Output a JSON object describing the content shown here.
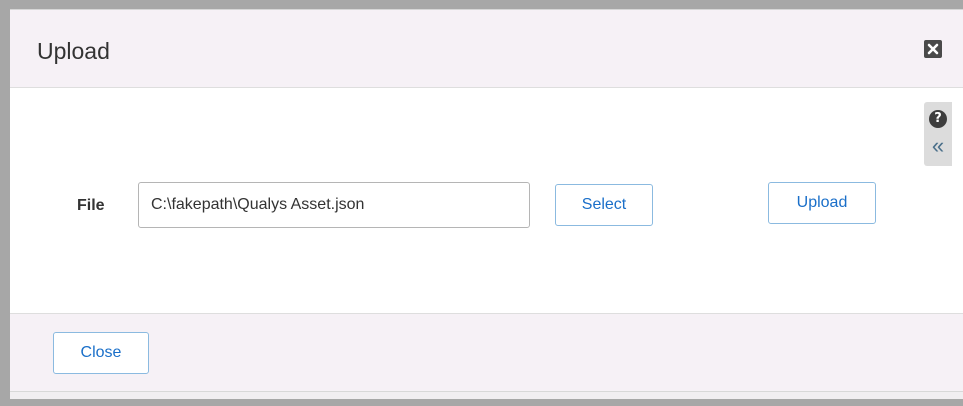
{
  "dialog": {
    "title": "Upload",
    "close_icon": "close-x-icon",
    "help_icon": "help-icon",
    "help_glyph": "?",
    "collapse_icon": "double-chevron-left-icon",
    "collapse_glyph": "«"
  },
  "form": {
    "file_label": "File",
    "file_value": "C:\\fakepath\\Qualys Asset.json",
    "select_label": "Select",
    "upload_label": "Upload"
  },
  "footer": {
    "close_label": "Close"
  },
  "colors": {
    "backdrop": "#a7a7a7",
    "header_bg": "#f6f1f6",
    "button_text": "#1a6fc9",
    "button_border": "#8bbae0"
  }
}
